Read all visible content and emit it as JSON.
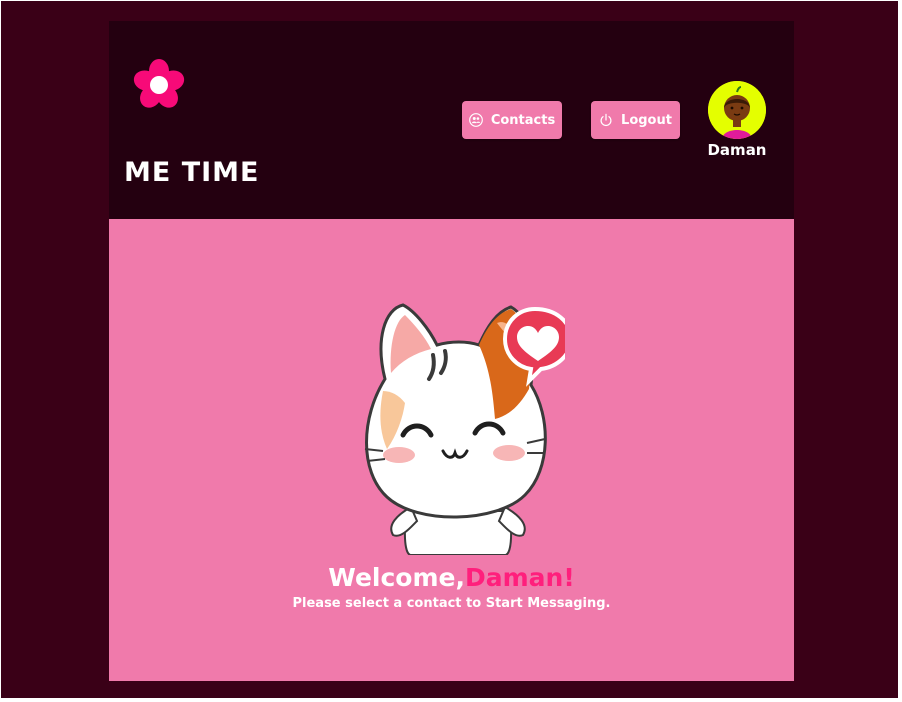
{
  "header": {
    "brand_title": "ME TIME",
    "logo_icon": "flower-icon",
    "buttons": {
      "contacts_label": "Contacts",
      "contacts_icon": "users-icon",
      "logout_label": "Logout",
      "logout_icon": "power-icon"
    },
    "user": {
      "name": "Daman",
      "avatar": "user-avatar"
    }
  },
  "welcome": {
    "greeting": "Welcome,",
    "name": "Daman!",
    "subtitle": "Please select a contact to Start Messaging.",
    "mascot": "cat-heart-illustration"
  },
  "colors": {
    "page_background": "#3a0017",
    "header_background": "#240010",
    "accent_pink": "#f07aab",
    "highlight_pink": "#ff1f7c",
    "avatar_background": "#e4ff00"
  }
}
